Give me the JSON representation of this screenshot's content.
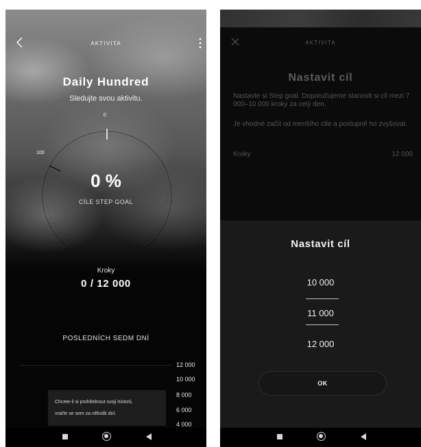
{
  "left_screen": {
    "header": {
      "title": "AKTIVITA"
    },
    "hero": {
      "title": "Daily Hundred",
      "subtitle": "Sledujte svou aktivitu."
    },
    "gauge": {
      "zero_label": "0",
      "hundred_label": "100",
      "percent": "0 %",
      "goal_label": "CÍLE STEP GOAL",
      "progress": 0
    },
    "steps": {
      "label": "Kroky",
      "value": "0 / 12 000"
    },
    "history": {
      "heading": "POSLEDNÍCH SEDM DNÍ",
      "axis_ticks": [
        "12 000",
        "10 000",
        "8 000",
        "6 000",
        "4 000"
      ],
      "note_line1": "Chcete-li si prohlédnout svoji historii,",
      "note_line2": "vraťte se sem za několik dní."
    }
  },
  "right_screen": {
    "header": {
      "title": "AKTIVITA"
    },
    "hero_title": "Nastavit cíl",
    "description1": "Nastavte si Step goal. Doporučujeme stanovit si cíl mezi 7 000–10 000 kroky za celý den.",
    "description2": "Je vhodné začít od menšího cíle a postupně ho zvyšovat.",
    "field": {
      "label": "Kroky",
      "value": "12 000"
    },
    "sheet": {
      "title": "Nastavit cíl",
      "options": [
        "10 000",
        "11 000",
        "12 000"
      ],
      "selected": "11 000",
      "ok_label": "OK"
    }
  },
  "icons": [
    "back-icon",
    "more-vert-icon",
    "close-icon",
    "nav-recents-icon",
    "nav-home-icon",
    "nav-back-icon"
  ]
}
